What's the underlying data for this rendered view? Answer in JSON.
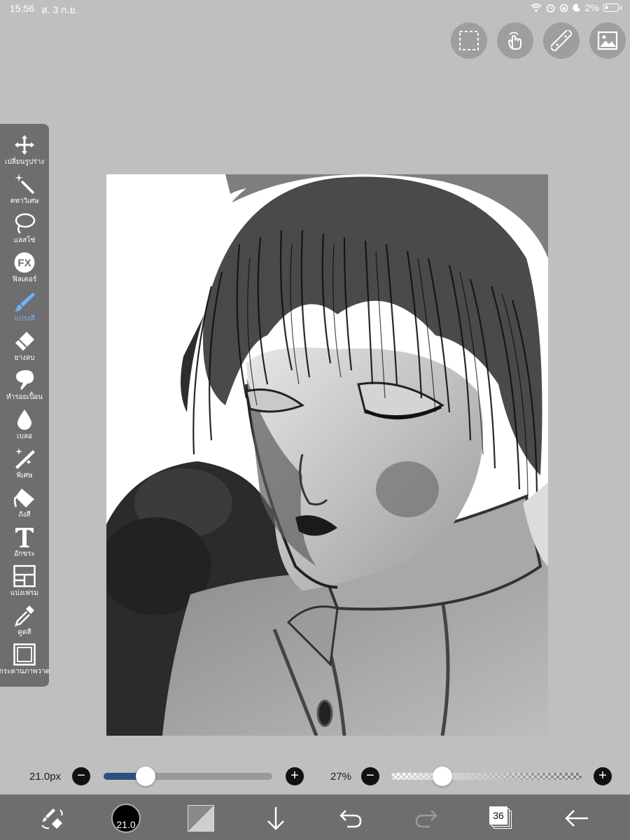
{
  "status": {
    "time": "15:56",
    "date": "ส. 3 ก.ย.",
    "battery": "2%"
  },
  "top_buttons": [
    "selection-icon",
    "gesture-hand-icon",
    "ruler-icon",
    "image-icon"
  ],
  "tools": [
    {
      "label": "เปลี่ยนรูปร่าง",
      "icon": "move-icon"
    },
    {
      "label": "คทาวิเศษ",
      "icon": "magic-wand-icon"
    },
    {
      "label": "แลสโซ่",
      "icon": "lasso-icon"
    },
    {
      "label": "ฟิลเตอร์",
      "icon": "fx-icon"
    },
    {
      "label": "แปรงสี",
      "icon": "brush-icon",
      "active": true
    },
    {
      "label": "ยางลบ",
      "icon": "eraser-icon"
    },
    {
      "label": "ทำรอยเปื้อน",
      "icon": "smudge-icon"
    },
    {
      "label": "เบลอ",
      "icon": "blur-drop-icon"
    },
    {
      "label": "พิเศษ",
      "icon": "special-brush-icon"
    },
    {
      "label": "ถังสี",
      "icon": "bucket-icon"
    },
    {
      "label": "อักขระ",
      "icon": "text-icon"
    },
    {
      "label": "แบ่งเฟรม",
      "icon": "frame-divider-icon"
    },
    {
      "label": "ดูดสี",
      "icon": "eyedropper-icon"
    },
    {
      "label": "กระดานภาพวาด",
      "icon": "canvas-board-icon"
    }
  ],
  "brush": {
    "size_label": "21.0px",
    "size_fraction": 0.25,
    "opacity_label": "27%",
    "opacity_fraction": 0.27
  },
  "bottom_bar": {
    "brush_preview_label": "21.0",
    "layer_count": "36"
  },
  "colors": {
    "accent": "#2f4f7f",
    "active_tool": "#6fb0ff",
    "panel": "#6e6e6e",
    "background": "#bfbfbf"
  }
}
